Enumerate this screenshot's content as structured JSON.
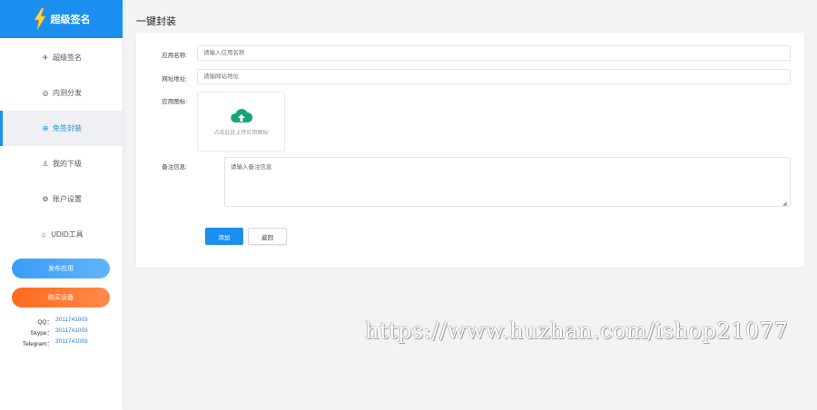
{
  "brand": {
    "name": "超级签名",
    "color": "#1a8fef"
  },
  "sidebar": {
    "items": [
      {
        "label": "超级签名",
        "icon": "send-icon",
        "active": false
      },
      {
        "label": "内测分发",
        "icon": "globe-icon",
        "active": false
      },
      {
        "label": "免签封装",
        "icon": "target-icon",
        "active": true
      },
      {
        "label": "我的下级",
        "icon": "user-icon",
        "active": false
      },
      {
        "label": "账户设置",
        "icon": "gear-icon",
        "active": false
      },
      {
        "label": "UDID工具",
        "icon": "tag-icon",
        "active": false
      }
    ],
    "publish_button": "发布应用",
    "buy_button": "购买设备"
  },
  "contacts": [
    {
      "label": "QQ：",
      "value": "3011741003"
    },
    {
      "label": "Skype：",
      "value": "3011741003"
    },
    {
      "label": "Telegram：",
      "value": "3011741003"
    }
  ],
  "page": {
    "title": "一键封装"
  },
  "form": {
    "app_name_label": "应用名称:",
    "app_name_placeholder": "请输入应用名称",
    "url_label": "网址地址:",
    "url_placeholder": "请输网站地址",
    "icon_label": "应用图标:",
    "upload_text": "点击此处上传应用图标",
    "remark_label": "备注信息:",
    "remark_value": "请输入备注信息",
    "add_button": "添加",
    "back_button": "返回"
  },
  "watermark": "https://www.huzhan.com/ishop21077",
  "colors": {
    "accent": "#1a8fef",
    "buy": "#ff6a1e",
    "upload_cloud": "#1aa37a"
  }
}
